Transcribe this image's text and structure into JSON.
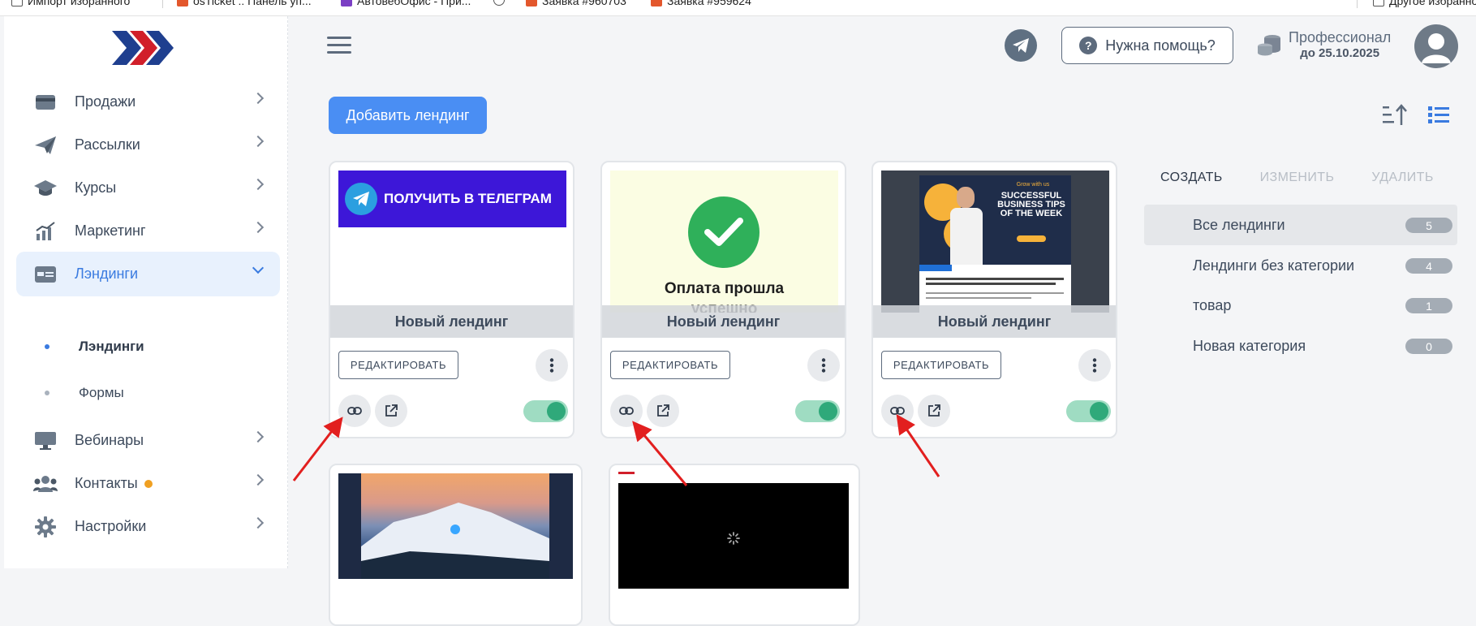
{
  "bookmarks": [
    {
      "label": "Импорт избранного"
    },
    {
      "label": "osTicket :: Панель уп..."
    },
    {
      "label": "АвтовебОфис - При..."
    },
    {
      "label": ""
    },
    {
      "label": "Заявка #960703"
    },
    {
      "label": "Заявка #959624"
    },
    {
      "label": "Другое избранное"
    }
  ],
  "sidebar": {
    "logo": "logo",
    "items": [
      {
        "label": "Продажи",
        "icon": "card-icon"
      },
      {
        "label": "Рассылки",
        "icon": "send-icon"
      },
      {
        "label": "Курсы",
        "icon": "graduation-cap-icon"
      },
      {
        "label": "Маркетинг",
        "icon": "chart-icon"
      },
      {
        "label": "Лэндинги",
        "icon": "landing-icon"
      },
      {
        "label": "Вебинары",
        "icon": "monitor-icon"
      },
      {
        "label": "Контакты",
        "icon": "users-icon"
      },
      {
        "label": "Настройки",
        "icon": "gear-icon"
      }
    ],
    "subitems": [
      {
        "label": "Лэндинги"
      },
      {
        "label": "Формы"
      }
    ]
  },
  "header": {
    "help_label": "Нужна помощь?",
    "plan_name": "Профессионал",
    "plan_date": "до 25.10.2025"
  },
  "toolbar": {
    "add_label": "Добавить лендинг"
  },
  "cards": [
    {
      "title": "Новый лендинг",
      "edit_label": "РЕДАКТИРОВАТЬ",
      "preview_text": "ПОЛУЧИТЬ В ТЕЛЕГРАМ",
      "enabled": true
    },
    {
      "title": "Новый лендинг",
      "edit_label": "РЕДАКТИРОВАТЬ",
      "preview_text": "Оплата прошла",
      "preview_text2": "успешно",
      "enabled": true
    },
    {
      "title": "Новый лендинг",
      "edit_label": "РЕДАКТИРОВАТЬ",
      "preview_text": "SUCCESSFUL BUSINESS TIPS OF THE WEEK",
      "preview_small": "Grow with us",
      "enabled": true
    }
  ],
  "categories": {
    "actions": [
      "СОЗДАТЬ",
      "ИЗМЕНИТЬ",
      "УДАЛИТЬ"
    ],
    "items": [
      {
        "name": "Все лендинги",
        "count": "5"
      },
      {
        "name": "Лендинги без категории",
        "count": "4"
      },
      {
        "name": "товар",
        "count": "1"
      },
      {
        "name": "Новая категория",
        "count": "0"
      }
    ]
  },
  "colors": {
    "accent": "#4a8ef3",
    "arrow": "#e21f1f",
    "toggle_on": "#2fa97a",
    "telegram_banner": "#3d17d8"
  }
}
